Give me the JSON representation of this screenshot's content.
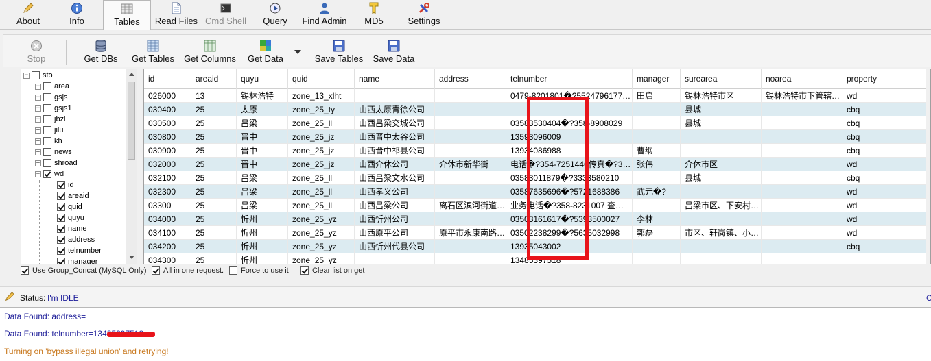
{
  "top_tabs": [
    {
      "label": "About",
      "icon": "pencil-icon"
    },
    {
      "label": "Info",
      "icon": "info-icon"
    },
    {
      "label": "Tables",
      "icon": "table-icon",
      "active": true
    },
    {
      "label": "Read Files",
      "icon": "file-icon"
    },
    {
      "label": "Cmd Shell",
      "icon": "terminal-icon",
      "disabled": true
    },
    {
      "label": "Query",
      "icon": "query-icon"
    },
    {
      "label": "Find Admin",
      "icon": "admin-icon"
    },
    {
      "label": "MD5",
      "icon": "key-icon"
    },
    {
      "label": "Settings",
      "icon": "tools-icon"
    }
  ],
  "toolbar": {
    "stop": "Stop",
    "get_dbs": "Get DBs",
    "get_tables": "Get Tables",
    "get_columns": "Get Columns",
    "get_data": "Get Data",
    "save_tables": "Save Tables",
    "save_data": "Save Data"
  },
  "tree": {
    "root": "sto",
    "tables": [
      "area",
      "gsjs",
      "gsjs1",
      "jbzl",
      "jilu",
      "kh",
      "news",
      "shroad"
    ],
    "expanded_table": "wd",
    "columns": [
      "id",
      "areaid",
      "quid",
      "quyu",
      "name",
      "address",
      "telnumber",
      "manager"
    ]
  },
  "grid": {
    "headers": [
      "id",
      "areaid",
      "quyu",
      "quid",
      "name",
      "address",
      "telnumber",
      "manager",
      "surearea",
      "noarea",
      "property"
    ],
    "rows": [
      [
        "026000",
        "13",
        "锡林浩特",
        "zone_13_xlht",
        "",
        "",
        "0479-8201801�?5524796177…",
        "田启",
        "锡林浩特市区",
        "锡林浩特市下管辖…",
        "wd"
      ],
      [
        "030400",
        "25",
        "太原",
        "zone_25_ty",
        "山西太原青徐公司",
        "",
        "",
        "",
        "县城",
        "",
        "cbq"
      ],
      [
        "030500",
        "25",
        "吕梁",
        "zone_25_ll",
        "山西吕梁交城公司",
        "",
        "03583530404�?358-8908029",
        "",
        "县城",
        "",
        "cbq"
      ],
      [
        "030800",
        "25",
        "晋中",
        "zone_25_jz",
        "山西晋中太谷公司",
        "",
        "13593096009",
        "",
        "",
        "",
        "cbq"
      ],
      [
        "030900",
        "25",
        "晋中",
        "zone_25_jz",
        "山西晋中祁县公司",
        "",
        "13934086988",
        "曹纲",
        "",
        "",
        "cbq"
      ],
      [
        "032000",
        "25",
        "晋中",
        "zone_25_jz",
        "山西介休公司",
        "介休市新华街",
        "电话�?354-7251446传真�?3…",
        "张伟",
        "介休市区",
        "",
        "wd"
      ],
      [
        "032100",
        "25",
        "吕梁",
        "zone_25_ll",
        "山西吕梁文水公司",
        "",
        "03583011879�?3333580210",
        "",
        "县城",
        "",
        "cbq"
      ],
      [
        "032300",
        "25",
        "吕梁",
        "zone_25_ll",
        "山西孝义公司",
        "",
        "03587635696�?5721688386",
        "武元�?",
        "",
        "",
        "wd"
      ],
      [
        "03300",
        "25",
        "吕梁",
        "zone_25_ll",
        "山西吕梁公司",
        "离石区滨河街道…",
        "业务电话�?358-8231007 查…",
        "",
        "吕梁市区、下安村…",
        "",
        "wd"
      ],
      [
        "034000",
        "25",
        "忻州",
        "zone_25_yz",
        "山西忻州公司",
        "",
        "03503161617�?5393500027",
        "李林",
        "",
        "",
        "wd"
      ],
      [
        "034100",
        "25",
        "忻州",
        "zone_25_yz",
        "山西原平公司",
        "原平市永康南路…",
        "03502238299�?5635032998",
        "郭磊",
        "市区、轩岗镇、小…",
        "",
        "wd"
      ],
      [
        "034200",
        "25",
        "忻州",
        "zone_25_yz",
        "山西忻州代县公司",
        "",
        "13935043002",
        "",
        "",
        "",
        "cbq"
      ],
      [
        "034300",
        "25",
        "忻州",
        "zone_25_yz",
        "",
        "",
        "13485397518",
        "",
        "",
        "",
        ""
      ]
    ]
  },
  "options": {
    "group_concat": "Use Group_Concat (MySQL Only)",
    "all_in_one": "All in one request.",
    "force": "Force to use it",
    "clear_list": "Clear list on get"
  },
  "status": {
    "label": "Status:",
    "value": "I'm IDLE",
    "right": "C"
  },
  "log": [
    "Data Found: address=",
    "Data Found: telnumber=13485397518",
    "Turning on 'bypass illegal union' and retrying!"
  ]
}
